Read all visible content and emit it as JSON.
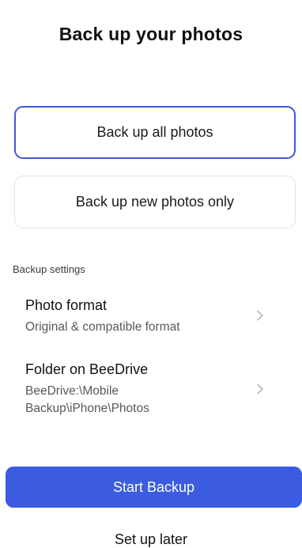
{
  "header": {
    "title": "Back up your photos"
  },
  "options": {
    "all_photos_label": "Back up all photos",
    "new_only_label": "Back up new photos only",
    "selected": "all_photos"
  },
  "settings": {
    "section_label": "Backup settings",
    "photo_format": {
      "title": "Photo format",
      "value": "Original & compatible format",
      "icon": "chevron-right-icon"
    },
    "folder": {
      "title": "Folder on BeeDrive",
      "value": "BeeDrive:\\Mobile Backup\\iPhone\\Photos",
      "icon": "chevron-right-icon"
    }
  },
  "actions": {
    "start_label": "Start Backup",
    "later_label": "Set up later"
  },
  "colors": {
    "accent": "#3b5ce0",
    "selected_border": "#3b5ccf",
    "chevron": "#b7b7bc"
  }
}
